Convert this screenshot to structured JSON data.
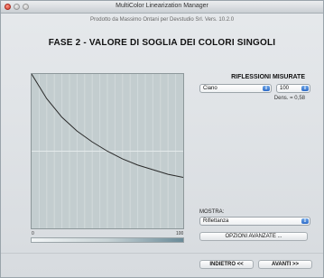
{
  "window": {
    "title": "MultiColor Linearization Manager",
    "subtitle": "Prodotto da Massimo Ontani per Devstudio Srl. Vers. 10.2.0"
  },
  "main": {
    "heading": "FASE 2 - VALORE DI SOGLIA DEI COLORI SINGOLI"
  },
  "chart_data": {
    "type": "line",
    "title": "",
    "xlabel": "",
    "ylabel": "",
    "xlim": [
      0,
      100
    ],
    "ylim": [
      0,
      100
    ],
    "x": [
      0,
      10,
      20,
      30,
      40,
      50,
      60,
      70,
      80,
      90,
      100
    ],
    "series": [
      {
        "values": [
          100,
          84,
          72,
          63,
          56,
          50,
          45,
          41,
          38,
          35,
          33
        ]
      }
    ],
    "ticks": {
      "x_min_label": "0",
      "x_max_label": "100"
    },
    "grid": true,
    "reference_line_y": 50
  },
  "reflections": {
    "heading": "RIFLESSIONI MISURATE",
    "color_select_value": "Ciano",
    "value_select_value": "100",
    "density_text": "Dens. = 0,58"
  },
  "mostra": {
    "label": "MOSTRA:",
    "select_value": "Riflettanza",
    "options_button": "OPZIONI AVANZATE ..."
  },
  "nav": {
    "back_label": "INDIETRO <<",
    "next_label": "AVANTI >>"
  },
  "icons": {
    "select_arrow": "updown-chevron-icon"
  }
}
